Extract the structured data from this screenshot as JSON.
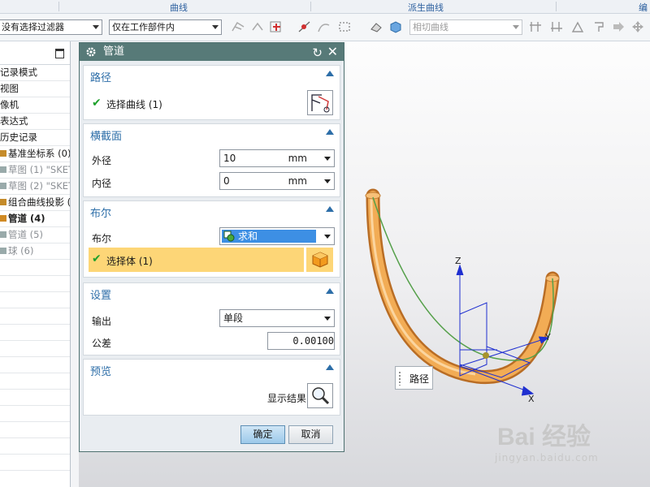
{
  "ribbon": {
    "groups": [
      "曲线",
      "派生曲线",
      "编"
    ]
  },
  "toolbar": {
    "filter_select": "没有选择过滤器",
    "scope_select": "仅在工作部件内",
    "curve_rule_select": "相切曲线"
  },
  "navigator": {
    "rows": [
      {
        "label": "记录模式",
        "style": "normal"
      },
      {
        "label": "视图",
        "style": "normal"
      },
      {
        "label": "像机",
        "style": "normal"
      },
      {
        "label": "表达式",
        "style": "normal"
      },
      {
        "label": "历史记录",
        "style": "normal"
      },
      {
        "label": "基准坐标系 (0)",
        "style": "normal"
      },
      {
        "label": "草图 (1) \"SKET",
        "style": "grey"
      },
      {
        "label": "草图 (2) \"SKET",
        "style": "grey"
      },
      {
        "label": "组合曲线投影 (",
        "style": "normal"
      },
      {
        "label": "管道 (4)",
        "style": "bold"
      },
      {
        "label": "管道 (5)",
        "style": "grey"
      },
      {
        "label": "球 (6)",
        "style": "grey"
      }
    ]
  },
  "dialog": {
    "title": "管道",
    "path": {
      "header": "路径",
      "select_curve": "选择曲线 (1)"
    },
    "cross_section": {
      "header": "横截面",
      "outer_label": "外径",
      "outer_value": "10",
      "outer_unit": "mm",
      "inner_label": "内径",
      "inner_value": "0",
      "inner_unit": "mm"
    },
    "boolean": {
      "header": "布尔",
      "label": "布尔",
      "value": "求和",
      "select_body": "选择体 (1)"
    },
    "settings": {
      "header": "设置",
      "output_label": "输出",
      "output_value": "单段",
      "tolerance_label": "公差",
      "tolerance_value": "0.00100"
    },
    "preview": {
      "header": "预览",
      "show_result": "显示结果"
    },
    "ok_label": "确定",
    "cancel_label": "取消"
  },
  "viewport": {
    "path_label": "路径",
    "axis_x": "X",
    "axis_y": "Y",
    "axis_z": "Z",
    "pipe_color": "#f0a84a",
    "curve_color": "#55a04a",
    "axis_color": "#1f2fd0"
  },
  "watermark": {
    "logo": "Bai 经验",
    "url": "jingyan.baidu.com"
  }
}
